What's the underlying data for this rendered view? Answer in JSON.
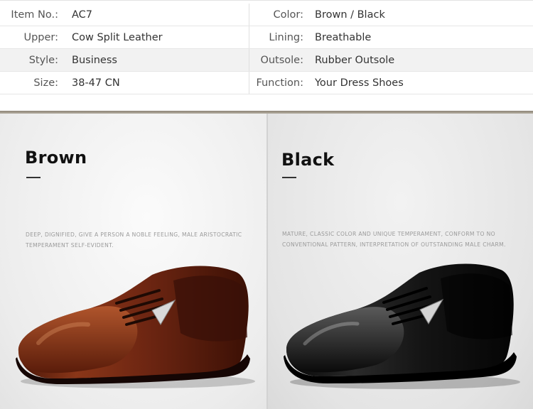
{
  "specs": [
    {
      "left_label": "Item No.:",
      "left_value": "AC7",
      "right_label": "Color:",
      "right_value": "Brown / Black"
    },
    {
      "left_label": "Upper:",
      "left_value": "Cow Split Leather",
      "right_label": "Lining:",
      "right_value": "Breathable"
    },
    {
      "left_label": "Style:",
      "left_value": "Business",
      "right_label": "Outsole:",
      "right_value": "Rubber Outsole"
    },
    {
      "left_label": "Size:",
      "left_value": "38-47 CN",
      "right_label": "Function:",
      "right_value": "Your Dress Shoes"
    }
  ],
  "products": {
    "brown": {
      "title": "Brown",
      "desc_line1": "DEEP, DIGNIFIED, GIVE A PERSON A NOBLE FEELING, MALE ARISTOCRATIC",
      "desc_line2": "TEMPERAMENT SELF-EVIDENT.",
      "color": "#6b2a14"
    },
    "black": {
      "title": "Black",
      "desc_line1": "MATURE, CLASSIC COLOR AND UNIQUE TEMPERAMENT, CONFORM TO NO",
      "desc_line2": "CONVENTIONAL PATTERN, INTERPRETATION OF OUTSTANDING MALE CHARM.",
      "color": "#111111"
    }
  }
}
